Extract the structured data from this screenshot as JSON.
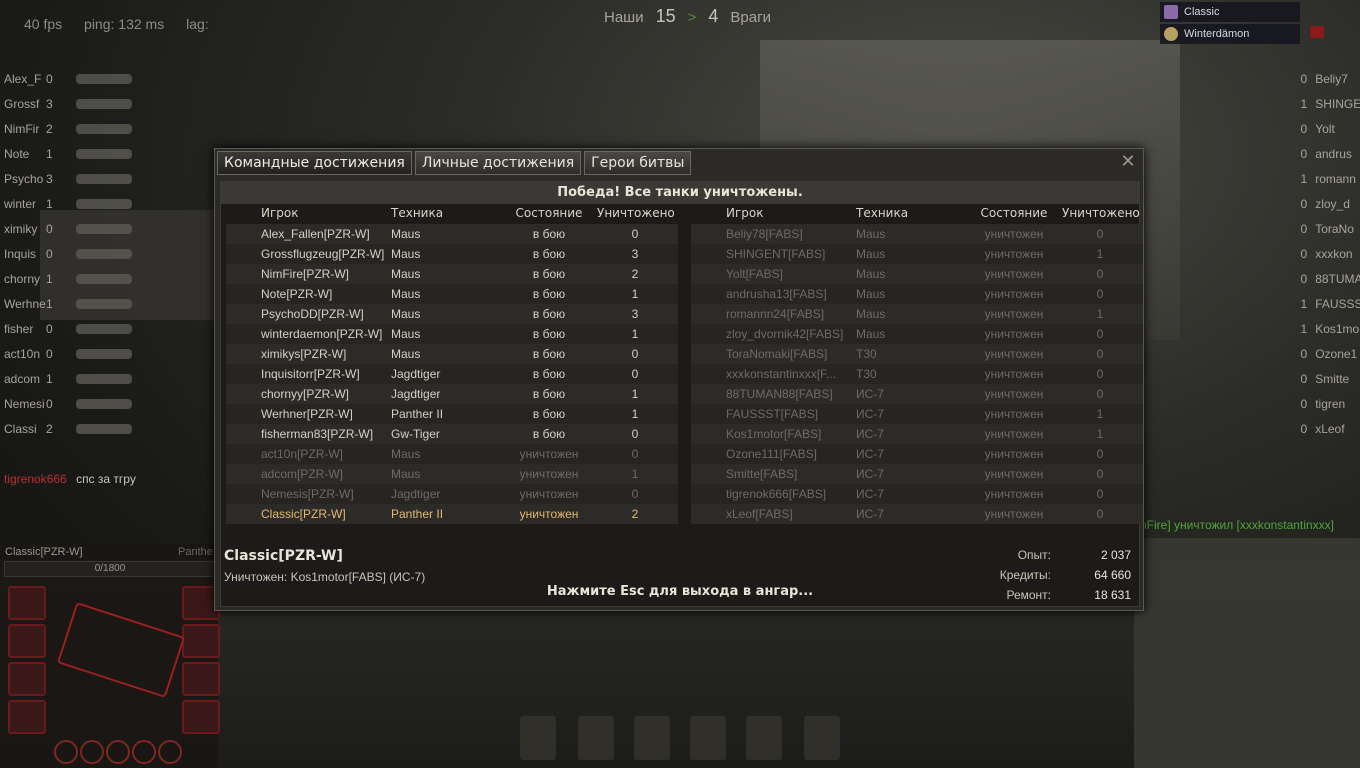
{
  "hud": {
    "fps": "40 fps",
    "ping": "ping: 132 ms",
    "lag": "lag:",
    "allies_label": "Наши",
    "allies_count": "15",
    "enemies_count": "4",
    "enemies_label": "Враги",
    "arrow": ">"
  },
  "squad": [
    "Classic",
    "Winterdämon"
  ],
  "left_team": [
    {
      "name": "Alex_F",
      "kills": "0"
    },
    {
      "name": "Grossf",
      "kills": "3"
    },
    {
      "name": "NimFir",
      "kills": "2"
    },
    {
      "name": "Note",
      "kills": "1"
    },
    {
      "name": "Psycho",
      "kills": "3"
    },
    {
      "name": "winter",
      "kills": "1"
    },
    {
      "name": "ximiky",
      "kills": "0"
    },
    {
      "name": "Inquis",
      "kills": "0"
    },
    {
      "name": "chorny",
      "kills": "1"
    },
    {
      "name": "Werhne",
      "kills": "1"
    },
    {
      "name": "fisher",
      "kills": "0"
    },
    {
      "name": "act10n",
      "kills": "0"
    },
    {
      "name": "adcom",
      "kills": "1"
    },
    {
      "name": "Nemesi",
      "kills": "0"
    },
    {
      "name": "Classi",
      "kills": "2"
    }
  ],
  "right_team": [
    {
      "name": "Beliy7",
      "kills": "0"
    },
    {
      "name": "SHINGE",
      "kills": "1"
    },
    {
      "name": "Yolt",
      "kills": "0"
    },
    {
      "name": "andrus",
      "kills": "0"
    },
    {
      "name": "romann",
      "kills": "1"
    },
    {
      "name": "zloy_d",
      "kills": "0"
    },
    {
      "name": "ToraNo",
      "kills": "0"
    },
    {
      "name": "xxxkon",
      "kills": "0"
    },
    {
      "name": "88TUMA",
      "kills": "0"
    },
    {
      "name": "FAUSSS",
      "kills": "1"
    },
    {
      "name": "Kos1mo",
      "kills": "1"
    },
    {
      "name": "Ozone1",
      "kills": "0"
    },
    {
      "name": "Smitte",
      "kills": "0"
    },
    {
      "name": "tigren",
      "kills": "0"
    },
    {
      "name": "xLeof",
      "kills": "0"
    }
  ],
  "chat": {
    "user": "tigrenok666",
    "message": "спс за тгру"
  },
  "kill_log": "nFire] уничтожил [xxxkonstantinxxx]",
  "damage_panel": {
    "player": "Classic[PZR-W]",
    "tank": "Panthe",
    "hp": "0/1800"
  },
  "window": {
    "tabs": [
      "Командные достижения",
      "Личные достижения",
      "Герои битвы"
    ],
    "close": "✕",
    "headline": "Победа! Все танки уничтожены.",
    "columns": [
      "Игрок",
      "Техника",
      "Состояние",
      "Уничтожено"
    ],
    "allies": [
      {
        "player": "Alex_Fallen[PZR-W]",
        "tank": "Maus",
        "state": "в бою",
        "kills": "0",
        "cls": "alive"
      },
      {
        "player": "Grossflugzeug[PZR-W]",
        "tank": "Maus",
        "state": "в бою",
        "kills": "3",
        "cls": "alive"
      },
      {
        "player": "NimFire[PZR-W]",
        "tank": "Maus",
        "state": "в бою",
        "kills": "2",
        "cls": "alive"
      },
      {
        "player": "Note[PZR-W]",
        "tank": "Maus",
        "state": "в бою",
        "kills": "1",
        "cls": "alive"
      },
      {
        "player": "PsychoDD[PZR-W]",
        "tank": "Maus",
        "state": "в бою",
        "kills": "3",
        "cls": "alive"
      },
      {
        "player": "winterdaemon[PZR-W]",
        "tank": "Maus",
        "state": "в бою",
        "kills": "1",
        "cls": "alive"
      },
      {
        "player": "ximikys[PZR-W]",
        "tank": "Maus",
        "state": "в бою",
        "kills": "0",
        "cls": "alive"
      },
      {
        "player": "Inquisitorr[PZR-W]",
        "tank": "Jagdtiger",
        "state": "в бою",
        "kills": "0",
        "cls": "alive"
      },
      {
        "player": "chornyy[PZR-W]",
        "tank": "Jagdtiger",
        "state": "в бою",
        "kills": "1",
        "cls": "alive"
      },
      {
        "player": "Werhner[PZR-W]",
        "tank": "Panther II",
        "state": "в бою",
        "kills": "1",
        "cls": "alive"
      },
      {
        "player": "fisherman83[PZR-W]",
        "tank": "Gw-Tiger",
        "state": "в бою",
        "kills": "0",
        "cls": "alive"
      },
      {
        "player": "act10n[PZR-W]",
        "tank": "Maus",
        "state": "уничтожен",
        "kills": "0",
        "cls": "dead"
      },
      {
        "player": "adcom[PZR-W]",
        "tank": "Maus",
        "state": "уничтожен",
        "kills": "1",
        "cls": "dead"
      },
      {
        "player": "Nemesis[PZR-W]",
        "tank": "Jagdtiger",
        "state": "уничтожен",
        "kills": "0",
        "cls": "dead"
      },
      {
        "player": "Classic[PZR-W]",
        "tank": "Panther II",
        "state": "уничтожен",
        "kills": "2",
        "cls": "me"
      }
    ],
    "enemies": [
      {
        "player": "Beliy78[FABS]",
        "tank": "Maus",
        "state": "уничтожен",
        "kills": "0"
      },
      {
        "player": "SHINGENT[FABS]",
        "tank": "Maus",
        "state": "уничтожен",
        "kills": "1"
      },
      {
        "player": "Yolt[FABS]",
        "tank": "Maus",
        "state": "уничтожен",
        "kills": "0"
      },
      {
        "player": "andrusha13[FABS]",
        "tank": "Maus",
        "state": "уничтожен",
        "kills": "0"
      },
      {
        "player": "romannn24[FABS]",
        "tank": "Maus",
        "state": "уничтожен",
        "kills": "1"
      },
      {
        "player": "zloy_dvornik42[FABS]",
        "tank": "Maus",
        "state": "уничтожен",
        "kills": "0"
      },
      {
        "player": "ToraNomaki[FABS]",
        "tank": "T30",
        "state": "уничтожен",
        "kills": "0"
      },
      {
        "player": "xxxkonstantinxxx[F...",
        "tank": "T30",
        "state": "уничтожен",
        "kills": "0"
      },
      {
        "player": "88TUMAN88[FABS]",
        "tank": "ИС-7",
        "state": "уничтожен",
        "kills": "0"
      },
      {
        "player": "FAUSSST[FABS]",
        "tank": "ИС-7",
        "state": "уничтожен",
        "kills": "1"
      },
      {
        "player": "Kos1motor[FABS]",
        "tank": "ИС-7",
        "state": "уничтожен",
        "kills": "1"
      },
      {
        "player": "Ozone111[FABS]",
        "tank": "ИС-7",
        "state": "уничтожен",
        "kills": "0"
      },
      {
        "player": "Smitte[FABS]",
        "tank": "ИС-7",
        "state": "уничтожен",
        "kills": "0"
      },
      {
        "player": "tigrenok666[FABS]",
        "tank": "ИС-7",
        "state": "уничтожен",
        "kills": "0"
      },
      {
        "player": "xLeof[FABS]",
        "tank": "ИС-7",
        "state": "уничтожен",
        "kills": "0"
      }
    ],
    "my_name": "Classic[PZR-W]",
    "killed_by": "Уничтожен: Kos1motor[FABS] (ИС-7)",
    "esc_hint": "Нажмите Esc для выхода в ангар...",
    "stats": [
      {
        "label": "Опыт:",
        "value": "2 037"
      },
      {
        "label": "Кредиты:",
        "value": "64 660"
      },
      {
        "label": "Ремонт:",
        "value": "18 631"
      }
    ]
  }
}
